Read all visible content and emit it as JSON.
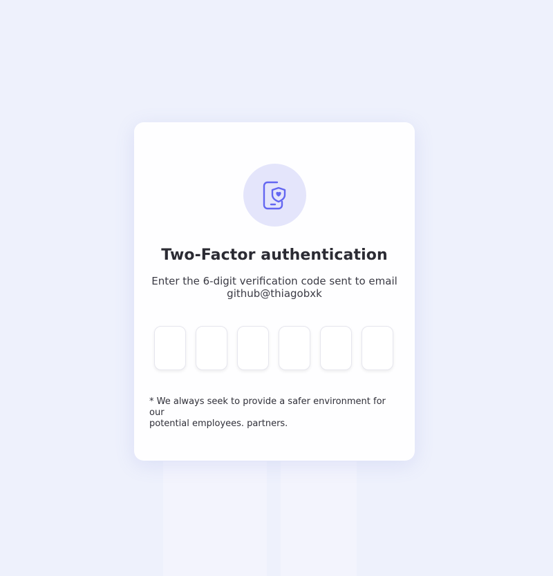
{
  "card": {
    "icon": "phone-shield-icon",
    "title": "Two-Factor authentication",
    "subtitle_line1": "Enter the 6-digit verification code sent to email",
    "subtitle_line2": "github@thiagobxk",
    "code_digits": [
      "",
      "",
      "",
      "",
      "",
      ""
    ],
    "note_line1": "* We always seek to provide a safer environment for our",
    "note_line2": "potential employees. partners."
  },
  "colors": {
    "accent": "#6366f1",
    "icon_circle": "#e4e5fb",
    "background": "#eef1fc",
    "card": "#fefeff"
  }
}
